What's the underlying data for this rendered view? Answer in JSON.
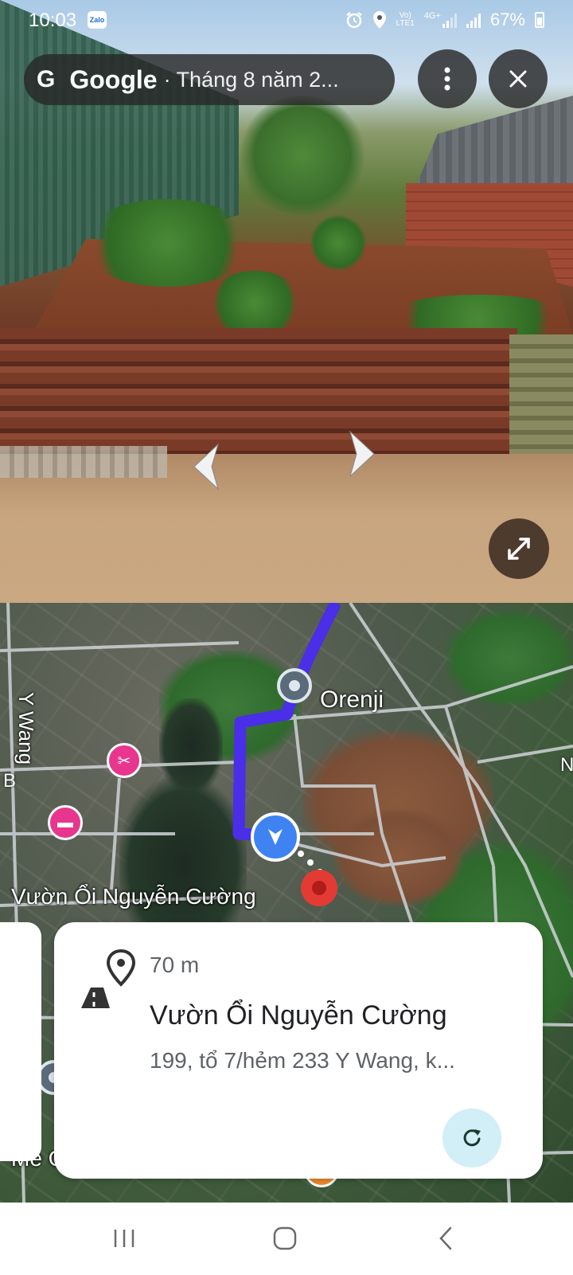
{
  "status_bar": {
    "time": "10:03",
    "app_badge": "Zalo",
    "network_label_top": "Vo)",
    "network_label_bottom": "LTE1",
    "network_type": "4G+",
    "battery": "67%"
  },
  "street_view": {
    "brand_icon": "G",
    "brand": "Google",
    "date_label": "· Tháng 8 năm 2..."
  },
  "map": {
    "poi_orenji": "Orenji",
    "street_ywang": "Y Wang",
    "edge_label_left": "B",
    "edge_label_right": "N",
    "destination_label": "Vườn Ổi Nguyễn Cường",
    "bottom_label": "Mê Garden Bbq&Coffee",
    "route_color": "#4a2ee8"
  },
  "card": {
    "distance": "70 m",
    "title": "Vườn Ổi Nguyễn Cường",
    "address": "199, tổ 7/hẻm 233 Y Wang, k..."
  },
  "colors": {
    "accent_blue": "#3f83f2",
    "pin_red": "#e33b33",
    "poi_pink": "#e8368e",
    "refresh_bg": "#d2eef7"
  },
  "icons": {
    "more": "more-vert-icon",
    "close": "close-icon",
    "expand": "expand-icon",
    "refresh": "refresh-icon",
    "place": "place-distance-icon"
  }
}
